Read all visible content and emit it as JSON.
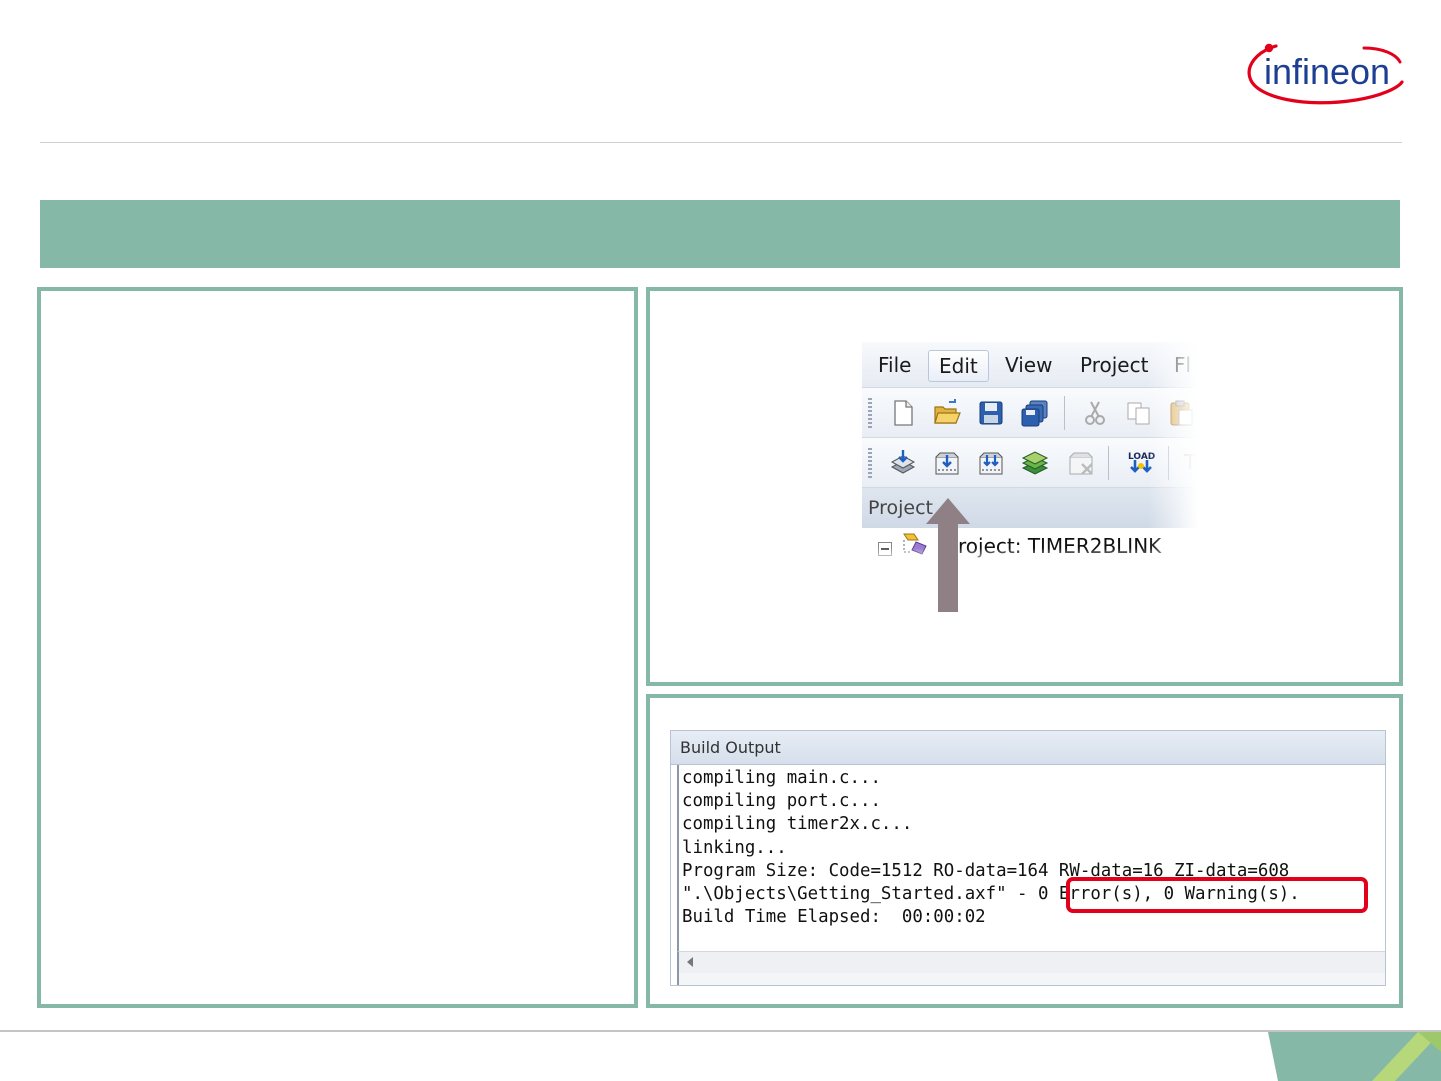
{
  "brand": {
    "name": "infineon",
    "accent_color": "#86b8a8",
    "logo_red": "#e3001b",
    "logo_blue": "#1c3f94"
  },
  "ide": {
    "menu": [
      "File",
      "Edit",
      "View",
      "Project",
      "Fl"
    ],
    "active_menu": "Edit",
    "toolbar1_icons": [
      "new-file-icon",
      "open-folder-icon",
      "save-icon",
      "save-all-icon",
      "cut-icon",
      "copy-icon",
      "paste-icon"
    ],
    "toolbar2_icons": [
      "translate-icon",
      "build-icon",
      "rebuild-icon",
      "batch-build-icon",
      "stop-build-icon",
      "load-icon"
    ],
    "load_label": "LOAD",
    "toolbar2_cut_text": "T",
    "project_window_label": "Project",
    "project_tree_label": "roject: TIMER2BLINK"
  },
  "build_output": {
    "title": "Build Output",
    "lines": [
      "compiling main.c...",
      "compiling port.c...",
      "compiling timer2x.c...",
      "linking...",
      "Program Size: Code=1512 RO-data=164 RW-data=16 ZI-data=608",
      "\".\\Objects\\Getting_Started.axf\" - 0 Error(s), 0 Warning(s).",
      "Build Time Elapsed:  00:00:02"
    ],
    "highlighted_result": "0 Error(s), 0 Warning(s)."
  }
}
